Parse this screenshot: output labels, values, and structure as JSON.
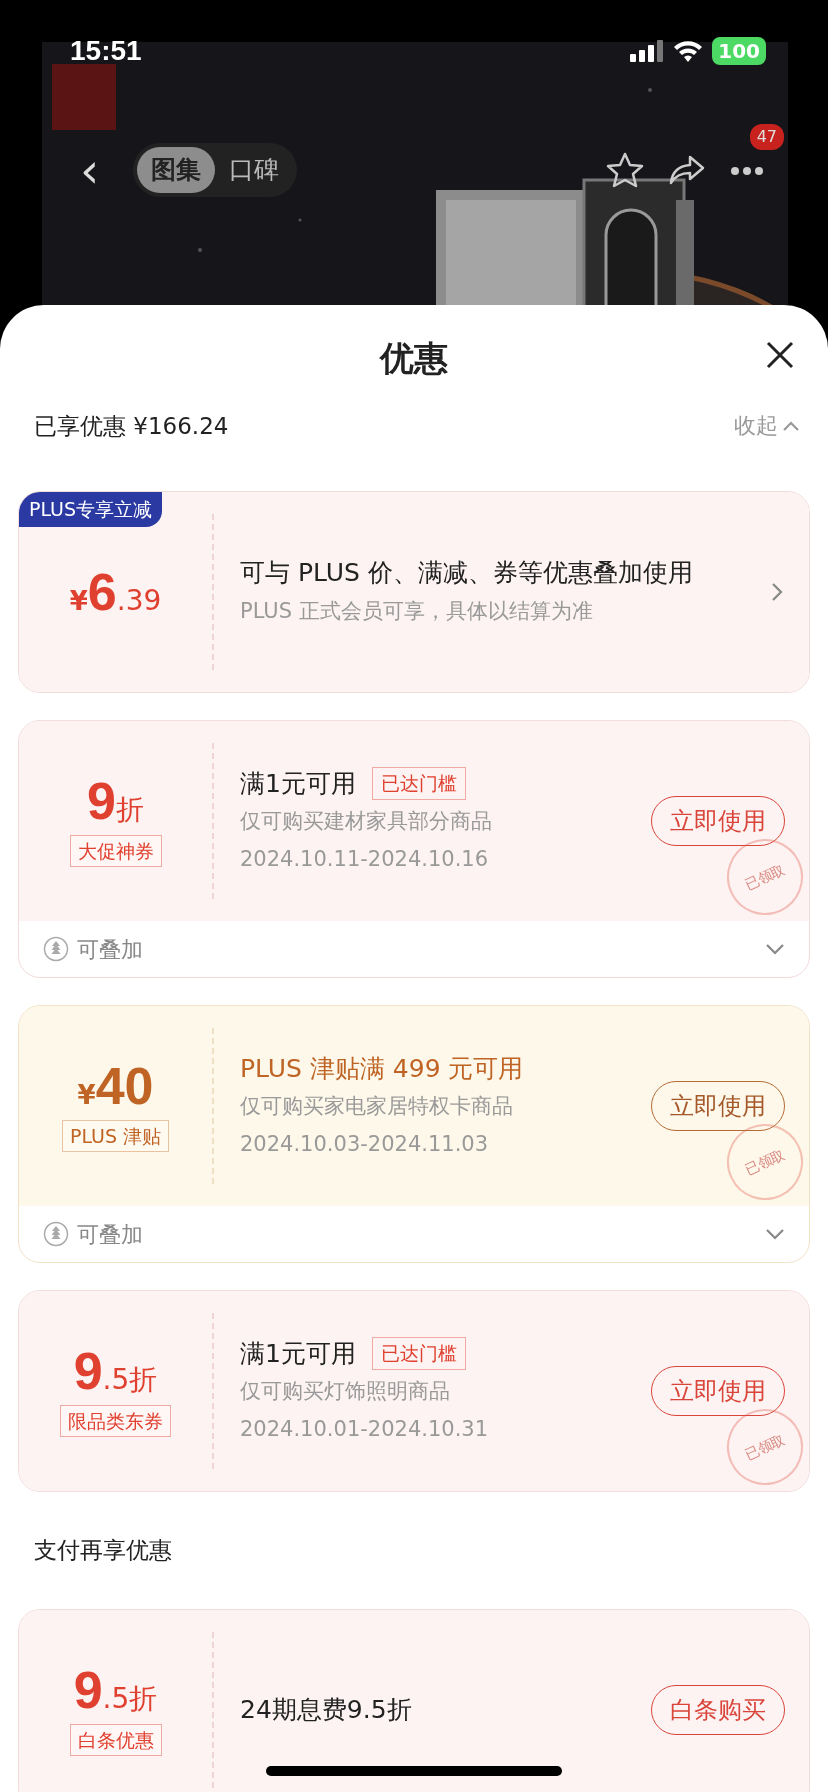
{
  "status_bar": {
    "time": "15:51",
    "battery": "100"
  },
  "header": {
    "back": "‹",
    "tabs": [
      {
        "label": "图集",
        "selected": true
      },
      {
        "label": "口碑",
        "selected": false
      }
    ],
    "more_badge": "47"
  },
  "sheet": {
    "title": "优惠",
    "summary": "已享优惠 ¥166.24",
    "collapse": "收起"
  },
  "coupons": [
    {
      "kind": "plus",
      "ribbon": "PLUS专享立减",
      "currency": "¥",
      "main": "6",
      "minor": ".39",
      "title": "可与 PLUS 价、满减、券等优惠叠加使用",
      "lines": [
        "PLUS 正式会员可享，具体以结算为准"
      ]
    },
    {
      "kind": "coupon",
      "main": "9",
      "minor": "折",
      "tag": "大促神券",
      "title": "满1元可用",
      "title_tag": "已达门槛",
      "lines": [
        "仅可购买建材家具部分商品",
        "2024.10.11-2024.10.16"
      ],
      "button": "立即使用",
      "stamp": "已领取",
      "footer": {
        "label": "可叠加",
        "expanded": false
      }
    },
    {
      "kind": "allowance",
      "currency": "¥",
      "main": "40",
      "tag": "PLUS 津贴",
      "title": "PLUS 津贴满 499 元可用",
      "lines": [
        "仅可购买家电家居特权卡商品",
        "2024.10.03-2024.11.03"
      ],
      "button": "立即使用",
      "stamp": "已领取",
      "footer": {
        "label": "可叠加",
        "expanded": false
      }
    },
    {
      "kind": "coupon",
      "main": "9",
      "minor": ".5折",
      "tag": "限品类东券",
      "title": "满1元可用",
      "title_tag": "已达门槛",
      "lines": [
        "仅可购买灯饰照明商品",
        "2024.10.01-2024.10.31"
      ],
      "button": "立即使用",
      "stamp": "已领取"
    }
  ],
  "pay_section": {
    "title": "支付再享优惠",
    "coupons": [
      {
        "kind": "coupon",
        "main": "9",
        "minor": ".5折",
        "tag": "白条优惠",
        "title": "24期息费9.5折",
        "button": "白条购买"
      }
    ]
  }
}
